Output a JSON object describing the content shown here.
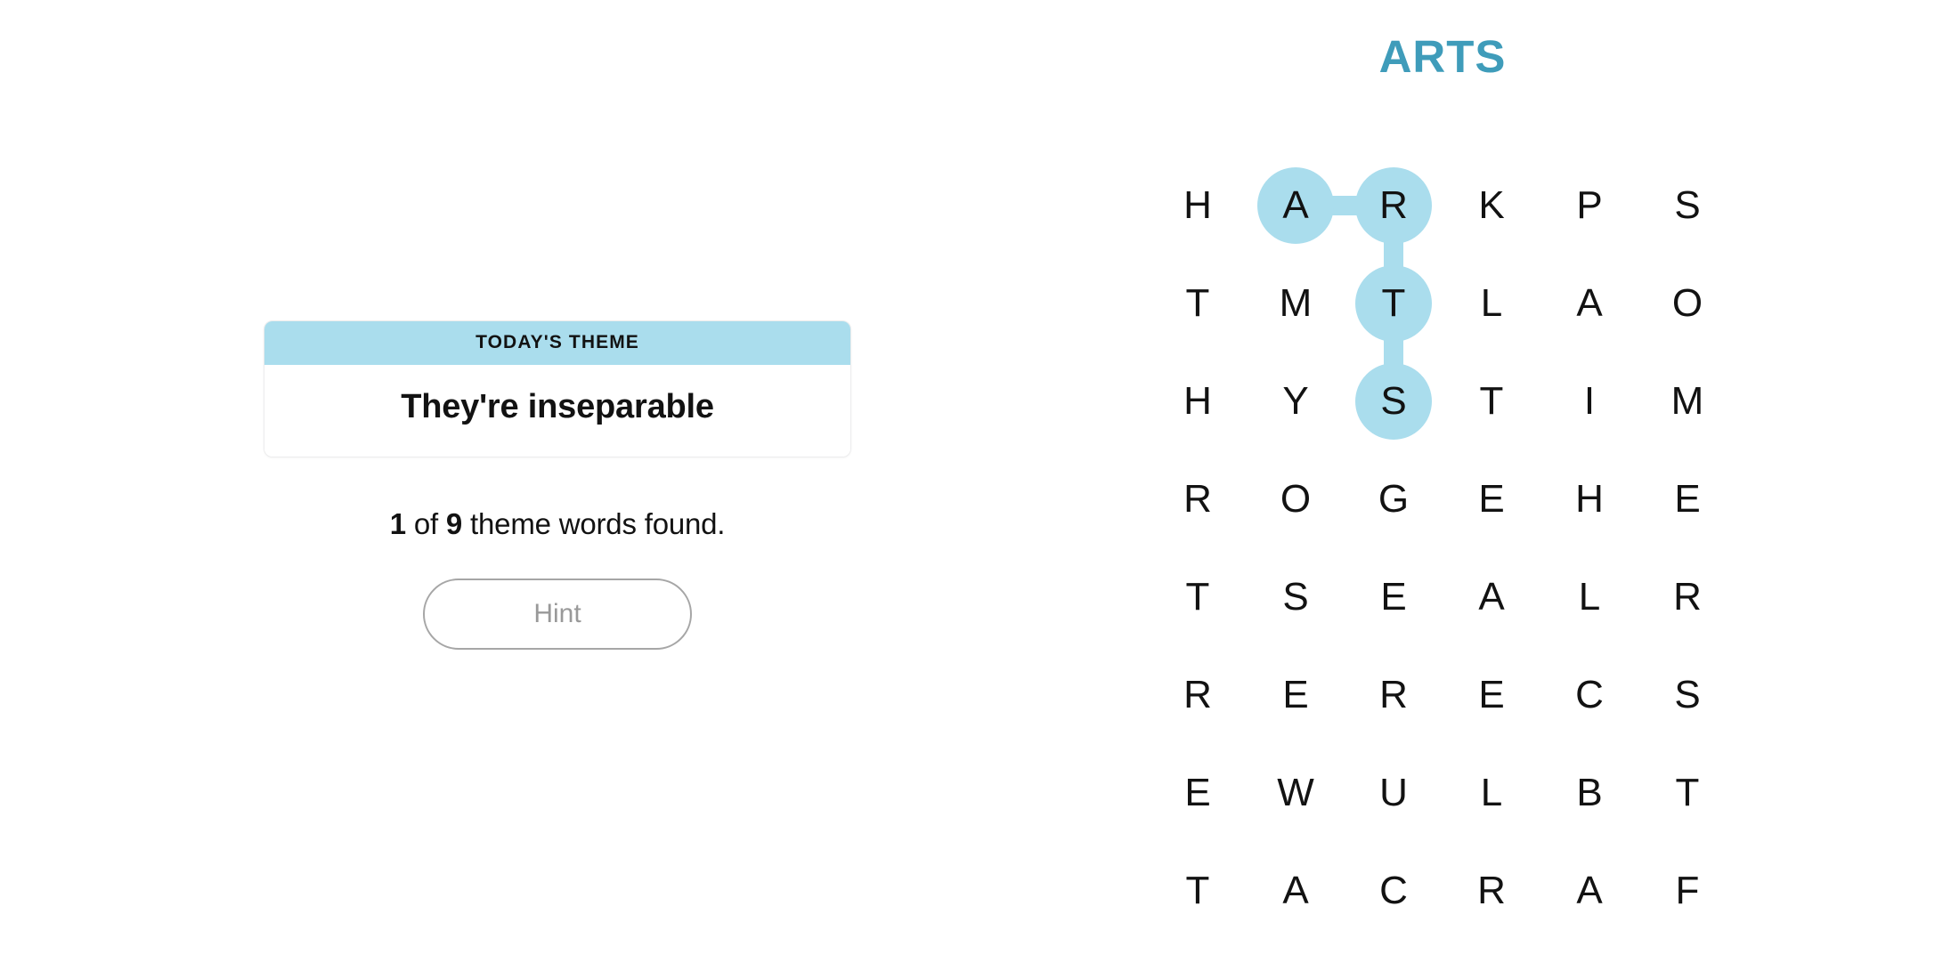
{
  "puzzle": {
    "title": "ARTS",
    "title_color": "#3f9cba",
    "highlight_color": "#aadded"
  },
  "theme_card": {
    "label": "TODAY'S THEME",
    "clue": "They're inseparable",
    "header_color": "#aadded"
  },
  "progress": {
    "found": "1",
    "of_word": "of",
    "total": "9",
    "suffix": "theme words found."
  },
  "hint": {
    "label": "Hint"
  },
  "grid": {
    "rows": 8,
    "cols": 6,
    "letters": [
      [
        "H",
        "A",
        "R",
        "K",
        "P",
        "S"
      ],
      [
        "T",
        "M",
        "T",
        "L",
        "A",
        "O"
      ],
      [
        "H",
        "Y",
        "S",
        "T",
        "I",
        "M"
      ],
      [
        "R",
        "O",
        "G",
        "E",
        "H",
        "E"
      ],
      [
        "T",
        "S",
        "E",
        "A",
        "L",
        "R"
      ],
      [
        "R",
        "E",
        "R",
        "E",
        "C",
        "S"
      ],
      [
        "E",
        "W",
        "U",
        "L",
        "B",
        "T"
      ],
      [
        "T",
        "A",
        "C",
        "R",
        "A",
        "F"
      ]
    ],
    "selection": {
      "cells": [
        {
          "row": 0,
          "col": 1,
          "letter": "A"
        },
        {
          "row": 0,
          "col": 2,
          "letter": "R"
        },
        {
          "row": 1,
          "col": 2,
          "letter": "T"
        },
        {
          "row": 2,
          "col": 2,
          "letter": "S"
        }
      ],
      "word": "ARTS"
    }
  }
}
